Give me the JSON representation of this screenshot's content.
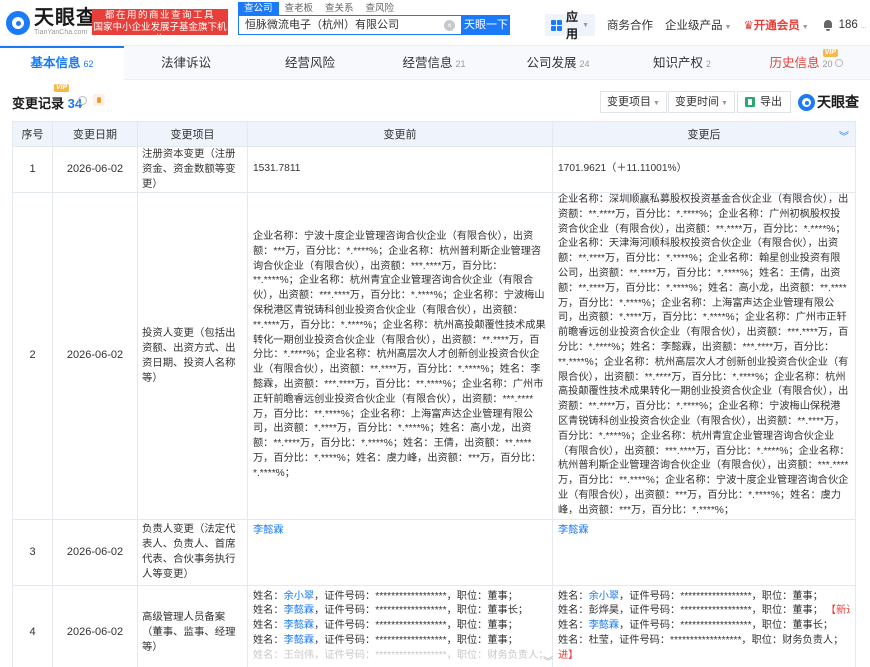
{
  "brand": {
    "name": "天眼查",
    "url": "TianYanCha.com",
    "slogan_line1": "都在用的商业查询工具",
    "slogan_line2": "国家中小企业发展子基金旗下机构"
  },
  "search": {
    "tabs": [
      "查公司",
      "查老板",
      "查关系",
      "查风险"
    ],
    "value": "恒脉微流电子（杭州）有限公司",
    "button": "天眼一下"
  },
  "nav": {
    "app": "应用",
    "items": [
      "商务合作",
      "企业级产品"
    ],
    "vip": "开通会员",
    "user": "186"
  },
  "main_tabs": [
    {
      "label": "基本信息",
      "count": "62"
    },
    {
      "label": "法律诉讼",
      "count": ""
    },
    {
      "label": "经营风险",
      "count": ""
    },
    {
      "label": "经营信息",
      "count": "21"
    },
    {
      "label": "公司发展",
      "count": "24"
    },
    {
      "label": "知识产权",
      "count": "2"
    },
    {
      "label": "历史信息",
      "count": "20",
      "badge": "VIP"
    }
  ],
  "section": {
    "title": "变更记录",
    "count": "34",
    "badge": "VIP",
    "filter1": "变更项目",
    "filter2": "变更时间",
    "export": "导出",
    "brand": "天眼查"
  },
  "table": {
    "headers": [
      "序号",
      "变更日期",
      "变更项目",
      "变更前",
      "变更后"
    ],
    "rows": [
      {
        "no": "1",
        "date": "2026-06-02",
        "item": "注册资本变更（注册资金、资金数额等变更）",
        "before": "1531.7811",
        "after": "1701.9621（＋11.11001%）"
      },
      {
        "no": "2",
        "date": "2026-06-02",
        "item": "投资人变更（包括出资额、出资方式、出资日期、投资人名称等）",
        "before": "企业名称：宁波十度企业管理咨询合伙企业（有限合伙），出资额：***万，百分比：*.****%；企业名称：杭州普利斯企业管理咨询合伙企业（有限合伙），出资额：***.****万，百分比：**.****%；企业名称：杭州青宜企业管理咨询合伙企业（有限合伙），出资额：***.****万，百分比：*.****%；企业名称：宁波梅山保税港区青锐铸科创业投资合伙企业（有限合伙），出资额：**.****万，百分比：*.****%；企业名称：杭州高投颠覆性技术成果转化一期创业投资合伙企业（有限合伙），出资额：**.****万，百分比：*.****%；企业名称：杭州高层次人才创新创业投资合伙企业（有限合伙），出资额：**.****万，百分比：*.****%；姓名：李懿霖，出资额：***.****万，百分比：**.****%；企业名称：广州市正轩前瞻睿远创业投资合伙企业（有限合伙），出资额：***.****万，百分比：**.****%；企业名称：上海富声达企业管理有限公司，出资额：*.****万，百分比：*.****%；姓名：高小龙，出资额：**.****万，百分比：*.****%；姓名：王倩，出资额：**.****万，百分比：*.****%；姓名：虞力峰，出资额：***万，百分比：*.****%；",
        "after": "企业名称：深圳顺赢私募股权投资基金合伙企业（有限合伙），出资额：**.****万，百分比：*.****%；企业名称：广州初枫股权投资合伙企业（有限合伙），出资额：**.****万，百分比：*.****%；企业名称：天津海河顺科股权投资合伙企业（有限合伙），出资额：**.****万，百分比：*.****%；企业名称：翰星创业投资有限公司，出资额：**.****万，百分比：*.****%；姓名：王倩，出资额：**.****万，百分比：*.****%；姓名：高小龙，出资额：**.****万，百分比：*.****%；企业名称：上海富声达企业管理有限公司，出资额：*.****万，百分比：*.****%；企业名称：广州市正轩前瞻睿远创业投资合伙企业（有限合伙），出资额：***.****万，百分比：*.****%；姓名：李懿霖，出资额：***.****万，百分比：**.****%；企业名称：杭州高层次人才创新创业投资合伙企业（有限合伙），出资额：**.****万，百分比：*.****%；企业名称：杭州高投颠覆性技术成果转化一期创业投资合伙企业（有限合伙），出资额：**.****万，百分比：*.****%；企业名称：宁波梅山保税港区青锐铸科创业投资合伙企业（有限合伙），出资额：**.****万，百分比：*.****%；企业名称：杭州青宜企业管理咨询合伙企业（有限合伙），出资额：***.****万，百分比：*.****%；企业名称：杭州普利斯企业管理咨询合伙企业（有限合伙），出资额：***.****万，百分比：**.****%；企业名称：宁波十度企业管理咨询合伙企业（有限合伙），出资额：***万，百分比：*.****%；姓名：虞力峰，出资额：***万，百分比：*.****%；"
      },
      {
        "no": "3",
        "date": "2026-06-02",
        "item": "负责人变更（法定代表人、负责人、首席代表、合伙事务执行人等变更）",
        "before": "李懿霖",
        "after": "李懿霖"
      },
      {
        "no": "4",
        "date": "2026-06-02",
        "item": "高级管理人员备案（董事、监事、经理等）",
        "before_lines": [
          {
            "prefix": "姓名：",
            "name": "余小翠",
            "mid": "，证件号码：******************，职位：",
            "role": "董事；",
            "tag": ""
          },
          {
            "prefix": "姓名：",
            "name": "李懿霖",
            "mid": "，证件号码：******************，职位：",
            "role": "董事长；",
            "tag": ""
          },
          {
            "prefix": "姓名：",
            "name": "李懿霖",
            "mid": "，证件号码：******************，职位：",
            "role": "董事；",
            "tag": ""
          },
          {
            "prefix": "姓名：",
            "name": "李懿霖",
            "mid": "，证件号码：******************，职位：",
            "role": "董事；",
            "tag": ""
          },
          {
            "prefix": "姓名：",
            "name": "王剑伟",
            "mid": "，证件号码：******************，职位：",
            "role": "财务负责人；",
            "tag": "【"
          }
        ],
        "after_lines": [
          {
            "prefix": "姓名：",
            "name": "余小翠",
            "mid": "，证件号码：******************，职位：",
            "role": "董事；",
            "tag": ""
          },
          {
            "prefix": "姓名：",
            "name": "彭烨昊",
            "mid": "，证件号码：******************，职位：",
            "role": "董事；",
            "tag": "【新进】"
          },
          {
            "prefix": "姓名：",
            "name": "李懿霖",
            "mid": "，证件号码：******************，职位：",
            "role": "董事长；",
            "tag": ""
          },
          {
            "prefix": "姓名：",
            "name": "杜莹",
            "mid": "，证件号码：******************，职位：",
            "role": "财务负责人；",
            "tag": "【新"
          },
          {
            "prefix": "",
            "name": "",
            "mid": "",
            "role": "",
            "tag": "进】"
          }
        ]
      }
    ]
  }
}
